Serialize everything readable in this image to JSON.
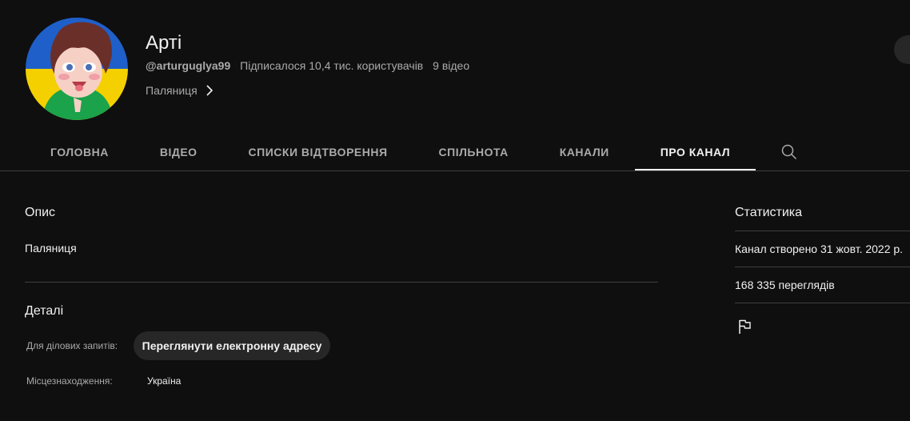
{
  "channel": {
    "name": "Арті",
    "handle": "@arturguglya99",
    "subscribers": "Підписалося 10,4 тис. користувачів",
    "videos": "9 відео",
    "description_link": "Паляниця"
  },
  "tabs": [
    {
      "label": "ГОЛОВНА"
    },
    {
      "label": "ВІДЕО"
    },
    {
      "label": "СПИСКИ ВІДТВОРЕННЯ"
    },
    {
      "label": "СПІЛЬНОТА"
    },
    {
      "label": "КАНАЛИ"
    },
    {
      "label": "ПРО КАНАЛ"
    }
  ],
  "active_tab": "ПРО КАНАЛ",
  "about": {
    "description_title": "Опис",
    "description_text": "Паляниця",
    "details_title": "Деталі",
    "business_label": "Для ділових запитів:",
    "email_button": "Переглянути електронну адресу",
    "location_label": "Місцезнаходження:",
    "location_value": "Україна"
  },
  "stats": {
    "title": "Статистика",
    "created": "Канал створено 31 жовт. 2022 р.",
    "views": "168 335 переглядів"
  },
  "icons": {
    "search": "search-icon",
    "chevron": "chevron-right-icon",
    "flag": "flag-icon"
  },
  "colors": {
    "background": "#0f0f0f",
    "text": "#f1f1f1",
    "secondary_text": "#aaaaaa",
    "divider": "#3f3f3f",
    "button_bg": "#272727"
  }
}
